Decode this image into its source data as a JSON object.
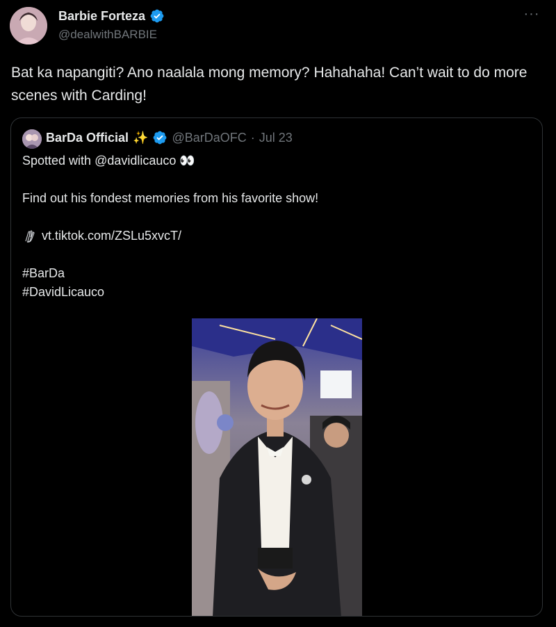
{
  "tweet": {
    "author_name": "Barbie Forteza",
    "author_handle": "@dealwithBARBIE",
    "more_label": "···",
    "text": "Bat ka napangiti? Ano naalala mong memory? Hahahaha! Can’t wait to do more scenes with Carding!"
  },
  "quote": {
    "name": "BarDa Official",
    "sparkle": "✨",
    "handle": "@BarDaOFC",
    "separator": "·",
    "date": "Jul 23",
    "line1": "Spotted with @davidlicauco 👀",
    "line2": "Find out his fondest memories from his favorite show!",
    "link": "vt.tiktok.com/ZSLu5xvcT/",
    "tag1": "#BarDa",
    "tag2": "#DavidLicauco"
  },
  "colors": {
    "background": "#000000",
    "text": "#e7e9ea",
    "muted": "#71767b",
    "verified": "#1d9bf0",
    "border": "#2f3336"
  },
  "icons": {
    "verified": "verified-badge-icon",
    "more": "more-horizontal-icon",
    "link": "clapping-hands-emoji-icon"
  }
}
